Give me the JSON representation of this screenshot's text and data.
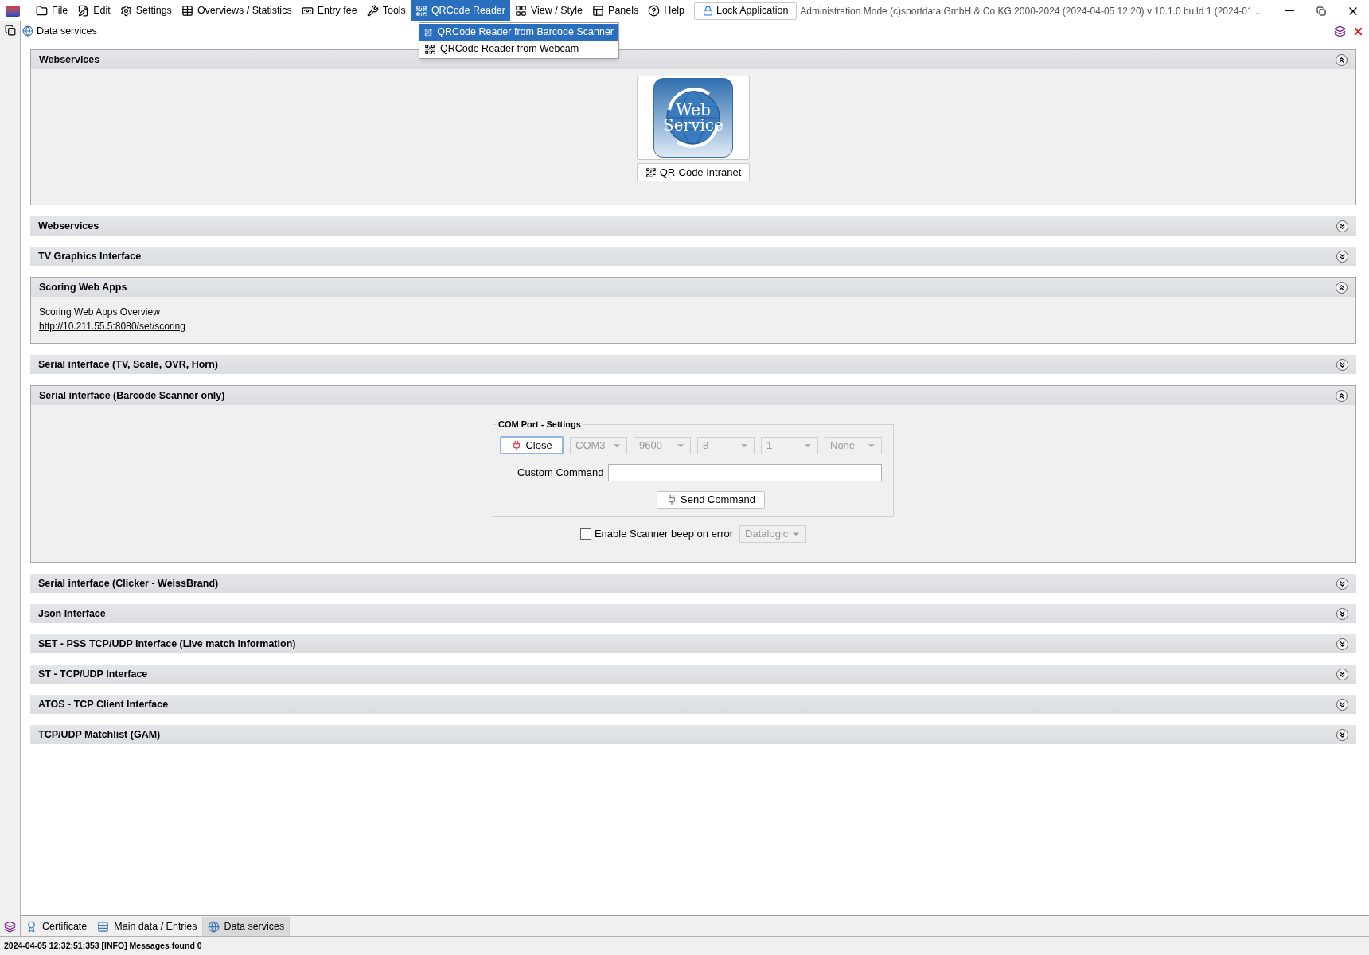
{
  "menu": {
    "items": [
      {
        "label": "File",
        "selected": false
      },
      {
        "label": "Edit",
        "selected": false
      },
      {
        "label": "Settings",
        "selected": false
      },
      {
        "label": "Overviews / Statistics",
        "selected": false
      },
      {
        "label": "Entry fee",
        "selected": false
      },
      {
        "label": "Tools",
        "selected": false
      },
      {
        "label": "QRCode Reader",
        "selected": true
      },
      {
        "label": "View / Style",
        "selected": false
      },
      {
        "label": "Panels",
        "selected": false
      },
      {
        "label": "Help",
        "selected": false
      }
    ],
    "lock_button": "Lock Application",
    "title": "Administration Mode (c)sportdata GmbH & Co KG 2000-2024 (2024-04-05 12:20)  v 10.1.0 build 1 (2024-01..."
  },
  "dropdown": {
    "items": [
      {
        "label": "QRCode Reader from Barcode Scanner",
        "selected": true
      },
      {
        "label": "QRCode Reader from Webcam",
        "selected": false
      }
    ]
  },
  "document_tab": "Data services",
  "sections": [
    {
      "title": "Webservices",
      "expanded": true,
      "kind": "logo",
      "logo_text": [
        "Web",
        "Service"
      ],
      "button": "QR-Code Intranet"
    },
    {
      "title": "Webservices",
      "expanded": false
    },
    {
      "title": "TV Graphics Interface",
      "expanded": false
    },
    {
      "title": "Scoring Web Apps",
      "expanded": true,
      "kind": "link",
      "text": "Scoring Web Apps Overview",
      "link": "http://10.211.55.5:8080/set/scoring"
    },
    {
      "title": "Serial interface (TV, Scale, OVR, Horn)",
      "expanded": false
    },
    {
      "title": "Serial interface (Barcode Scanner only)",
      "expanded": true,
      "kind": "com",
      "group_title": "COM Port - Settings",
      "close_button": "Close",
      "dropdowns": [
        {
          "value": "COM3",
          "disabled": true
        },
        {
          "value": "9600",
          "disabled": true
        },
        {
          "value": "8",
          "disabled": true
        },
        {
          "value": "1",
          "disabled": true
        },
        {
          "value": "None",
          "disabled": true
        }
      ],
      "command_label": "Custom Command",
      "send_button": "Send Command",
      "beep_checkbox": {
        "label": "Enable Scanner beep on error",
        "checked": false
      },
      "scanner_dropdown": {
        "value": "Datalogic",
        "disabled": true
      }
    },
    {
      "title": "Serial interface (Clicker - WeissBrand)",
      "expanded": false
    },
    {
      "title": "Json Interface",
      "expanded": false
    },
    {
      "title": "SET - PSS TCP/UDP Interface (Live match information)",
      "expanded": false
    },
    {
      "title": "ST - TCP/UDP Interface",
      "expanded": false
    },
    {
      "title": "ATOS - TCP Client Interface",
      "expanded": false
    },
    {
      "title": "TCP/UDP Matchlist (GAM)",
      "expanded": false
    }
  ],
  "bottom_tabs": [
    {
      "label": "Certificate",
      "selected": false
    },
    {
      "label": "Main data / Entries",
      "selected": false
    },
    {
      "label": "Data services",
      "selected": true
    }
  ],
  "status_bar": "2024-04-05 12:32:51:353 [INFO] Messages found 0"
}
